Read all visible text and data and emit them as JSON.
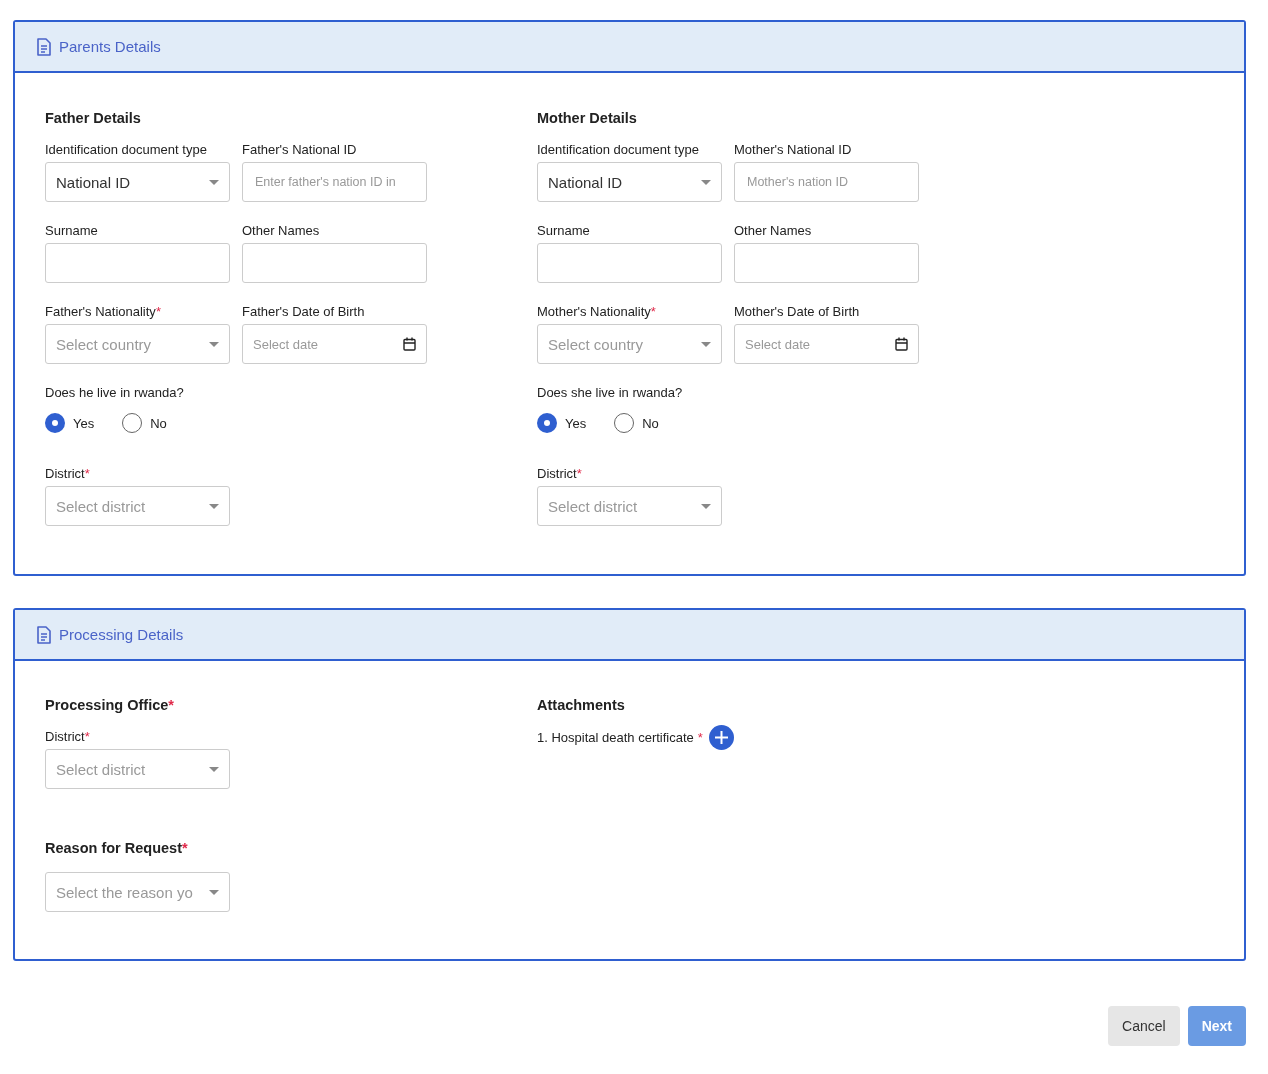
{
  "sections": [
    {
      "title": "Parents Details",
      "columns": [
        {
          "blocks": [
            {
              "kind": "heading",
              "text": "Father Details"
            },
            {
              "kind": "row",
              "fields": [
                {
                  "kind": "select",
                  "label": "Identification document type",
                  "value": "National ID"
                },
                {
                  "kind": "input",
                  "label": "Father's National ID",
                  "placeholder": "Enter father's nation ID in"
                }
              ]
            },
            {
              "kind": "row",
              "fields": [
                {
                  "kind": "input",
                  "label": "Surname"
                },
                {
                  "kind": "input",
                  "label": "Other Names"
                }
              ]
            },
            {
              "kind": "row",
              "fields": [
                {
                  "kind": "select",
                  "label": "Father's Nationality",
                  "mark": "*",
                  "placeholder": "Select country"
                },
                {
                  "kind": "date",
                  "label": "Father's Date of Birth",
                  "placeholder": "Select date"
                }
              ]
            },
            {
              "kind": "row",
              "fields": [
                {
                  "kind": "radio",
                  "label": "Does he live in rwanda?",
                  "options": [
                    {
                      "label": "Yes",
                      "selected": true
                    },
                    {
                      "label": "No",
                      "selected": false
                    }
                  ]
                }
              ]
            },
            {
              "kind": "row",
              "fields": [
                {
                  "kind": "select",
                  "label": "District",
                  "mark": "*",
                  "placeholder": "Select district"
                }
              ]
            }
          ]
        },
        {
          "blocks": [
            {
              "kind": "heading",
              "text": "Mother Details"
            },
            {
              "kind": "row",
              "fields": [
                {
                  "kind": "select",
                  "label": "Identification document type",
                  "value": "National ID"
                },
                {
                  "kind": "input",
                  "label": "Mother's National ID",
                  "placeholder": "Mother's nation ID"
                }
              ]
            },
            {
              "kind": "row",
              "fields": [
                {
                  "kind": "input",
                  "label": "Surname"
                },
                {
                  "kind": "input",
                  "label": "Other Names"
                }
              ]
            },
            {
              "kind": "row",
              "fields": [
                {
                  "kind": "select",
                  "label": "Mother's Nationality",
                  "mark": "*",
                  "placeholder": "Select country"
                },
                {
                  "kind": "date",
                  "label": "Mother's Date of Birth",
                  "placeholder": "Select date"
                }
              ]
            },
            {
              "kind": "row",
              "fields": [
                {
                  "kind": "radio",
                  "label": "Does she live in rwanda?",
                  "options": [
                    {
                      "label": "Yes",
                      "selected": true
                    },
                    {
                      "label": "No",
                      "selected": false
                    }
                  ]
                }
              ]
            },
            {
              "kind": "row",
              "fields": [
                {
                  "kind": "select",
                  "label": "District",
                  "mark": "*",
                  "placeholder": "Select district"
                }
              ]
            }
          ]
        }
      ]
    },
    {
      "title": "Processing Details",
      "columns": [
        {
          "blocks": [
            {
              "kind": "heading",
              "text": "Processing Office",
              "mark": "*"
            },
            {
              "kind": "row",
              "fields": [
                {
                  "kind": "select",
                  "label": "District",
                  "mark": "*",
                  "placeholder": "Select district"
                }
              ]
            },
            {
              "kind": "heading",
              "text": "Reason for Request",
              "mark": "*"
            },
            {
              "kind": "row",
              "fields": [
                {
                  "kind": "select",
                  "placeholder": "Select the reason yo"
                }
              ]
            }
          ]
        },
        {
          "blocks": [
            {
              "kind": "heading",
              "text": "Attachments"
            },
            {
              "kind": "attachment",
              "text": "1. Hospital death certificate",
              "mark": "*"
            }
          ]
        }
      ]
    }
  ],
  "buttons": [
    {
      "label": "Cancel",
      "kind": "secondary"
    },
    {
      "label": "Next",
      "kind": "primary"
    }
  ]
}
